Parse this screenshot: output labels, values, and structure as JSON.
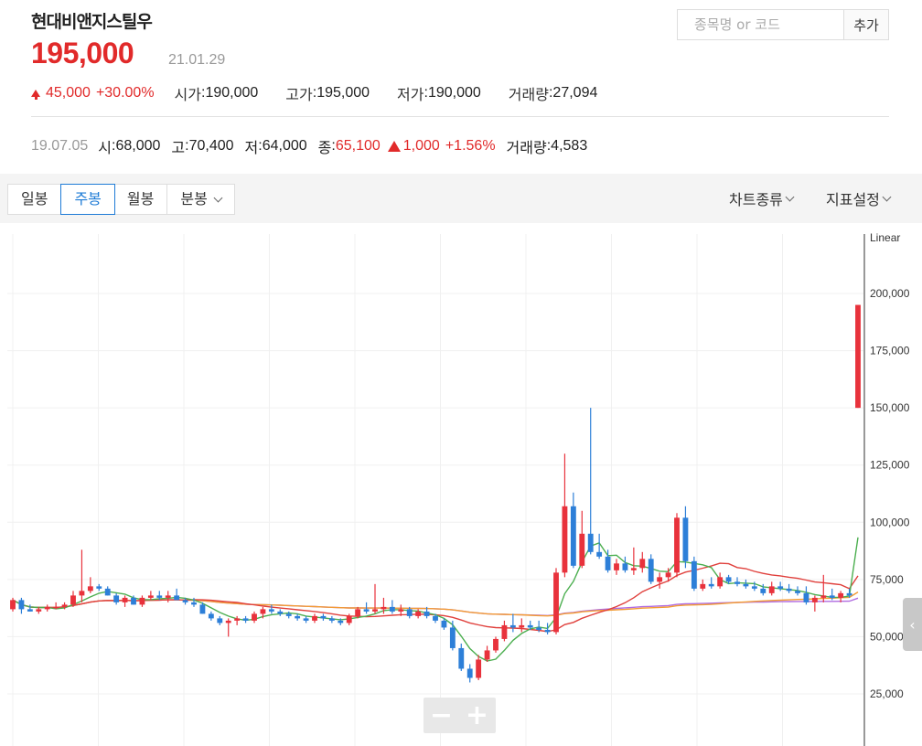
{
  "stock": {
    "name": "현대비앤지스틸우",
    "price": "195,000",
    "date": "21.01.29",
    "change": "45,000",
    "change_pct": "+30.00%",
    "open_label": "시가",
    "open": "190,000",
    "high_label": "고가",
    "high": "195,000",
    "low_label": "저가",
    "low": "190,000",
    "volume_label": "거래량",
    "volume": "27,094"
  },
  "search": {
    "placeholder": "종목명 or 코드",
    "add_label": "추가"
  },
  "history": {
    "date": "19.07.05",
    "open_label": "시",
    "open": "68,000",
    "high_label": "고",
    "high": "70,400",
    "low_label": "저",
    "low": "64,000",
    "close_label": "종",
    "close": "65,100",
    "change": "1,000",
    "change_pct": "+1.56%",
    "volume_label": "거래량",
    "volume": "4,583"
  },
  "toolbar": {
    "tabs": [
      {
        "label": "일봉"
      },
      {
        "label": "주봉"
      },
      {
        "label": "월봉"
      },
      {
        "label": "분봉"
      }
    ],
    "active_tab": "주봉",
    "chart_type_label": "차트종류",
    "indicator_label": "지표설정"
  },
  "colors": {
    "up": "#e8323c",
    "down": "#2d7fd8",
    "ma5": "#4caf50",
    "ma20": "#e0403c",
    "ma60": "#f39c34",
    "ma120": "#b06be0"
  },
  "chart_data": {
    "type": "candlestick",
    "scale_label": "Linear",
    "ylim": [
      0,
      225000
    ],
    "yticks": [
      25000,
      50000,
      75000,
      100000,
      125000,
      150000,
      175000,
      200000
    ],
    "ytick_labels": [
      "25,000",
      "50,000",
      "75,000",
      "100,000",
      "125,000",
      "150,000",
      "175,000",
      "200,000"
    ],
    "candles": [
      [
        62000,
        67000,
        61000,
        66000
      ],
      [
        66000,
        67000,
        60000,
        62000
      ],
      [
        62000,
        64000,
        61000,
        61000
      ],
      [
        61000,
        63000,
        60000,
        62000
      ],
      [
        62000,
        64000,
        61000,
        63000
      ],
      [
        63000,
        65000,
        62000,
        63000
      ],
      [
        63000,
        65000,
        62000,
        64000
      ],
      [
        64000,
        70000,
        63000,
        68000
      ],
      [
        68000,
        88000,
        65000,
        70000
      ],
      [
        70000,
        76000,
        69000,
        72000
      ],
      [
        72000,
        73000,
        70000,
        71000
      ],
      [
        71000,
        72000,
        68000,
        68000
      ],
      [
        68000,
        69000,
        64000,
        65000
      ],
      [
        65000,
        68000,
        63000,
        67000
      ],
      [
        67000,
        68000,
        64000,
        64000
      ],
      [
        64000,
        68000,
        63000,
        67000
      ],
      [
        67000,
        70000,
        66000,
        68000
      ],
      [
        68000,
        70000,
        66000,
        67000
      ],
      [
        67000,
        70000,
        65000,
        68000
      ],
      [
        68000,
        71000,
        66000,
        66000
      ],
      [
        66000,
        67000,
        64000,
        65000
      ],
      [
        65000,
        67000,
        63000,
        64000
      ],
      [
        64000,
        65000,
        60000,
        60000
      ],
      [
        60000,
        61000,
        57000,
        58000
      ],
      [
        58000,
        59000,
        55000,
        56000
      ],
      [
        56000,
        58000,
        50000,
        57000
      ],
      [
        57000,
        59000,
        55000,
        58000
      ],
      [
        58000,
        59000,
        56000,
        57000
      ],
      [
        57000,
        61000,
        56000,
        60000
      ],
      [
        60000,
        63000,
        58000,
        62000
      ],
      [
        62000,
        64000,
        60000,
        61000
      ],
      [
        61000,
        62000,
        59000,
        60000
      ],
      [
        60000,
        61000,
        58000,
        59000
      ],
      [
        59000,
        60000,
        57000,
        58000
      ],
      [
        58000,
        59000,
        56000,
        57000
      ],
      [
        57000,
        60000,
        56000,
        59000
      ],
      [
        59000,
        60000,
        57000,
        58000
      ],
      [
        58000,
        59000,
        56000,
        57000
      ],
      [
        57000,
        58000,
        55000,
        56000
      ],
      [
        56000,
        60000,
        55000,
        59000
      ],
      [
        59000,
        63000,
        58000,
        62000
      ],
      [
        62000,
        65000,
        60000,
        61000
      ],
      [
        61000,
        73000,
        60000,
        62000
      ],
      [
        62000,
        67000,
        60000,
        63000
      ],
      [
        63000,
        66000,
        60000,
        61000
      ],
      [
        61000,
        64000,
        59000,
        62000
      ],
      [
        62000,
        63000,
        58000,
        59000
      ],
      [
        59000,
        62000,
        58000,
        61000
      ],
      [
        61000,
        63000,
        58000,
        59000
      ],
      [
        59000,
        60000,
        56000,
        57000
      ],
      [
        57000,
        58000,
        53000,
        54000
      ],
      [
        54000,
        57000,
        44000,
        45000
      ],
      [
        45000,
        47000,
        35000,
        36000
      ],
      [
        36000,
        38000,
        30000,
        32000
      ],
      [
        32000,
        42000,
        31000,
        40000
      ],
      [
        40000,
        46000,
        39000,
        44000
      ],
      [
        44000,
        50000,
        43000,
        49000
      ],
      [
        49000,
        57000,
        48000,
        55000
      ],
      [
        55000,
        60000,
        52000,
        54000
      ],
      [
        54000,
        58000,
        52000,
        55000
      ],
      [
        55000,
        57000,
        53000,
        54000
      ],
      [
        54000,
        57000,
        52000,
        53000
      ],
      [
        53000,
        56000,
        51000,
        52000
      ],
      [
        52000,
        80000,
        51000,
        78000
      ],
      [
        78000,
        130000,
        76000,
        107000
      ],
      [
        107000,
        113000,
        80000,
        81000
      ],
      [
        81000,
        105000,
        80000,
        95000
      ],
      [
        95000,
        150000,
        86000,
        87000
      ],
      [
        87000,
        95000,
        84000,
        85000
      ],
      [
        85000,
        88000,
        78000,
        79000
      ],
      [
        79000,
        84000,
        77000,
        82000
      ],
      [
        82000,
        85000,
        78000,
        79000
      ],
      [
        79000,
        89000,
        77000,
        80000
      ],
      [
        80000,
        87000,
        78000,
        84000
      ],
      [
        84000,
        86000,
        73000,
        74000
      ],
      [
        74000,
        78000,
        71000,
        76000
      ],
      [
        76000,
        80000,
        74000,
        78000
      ],
      [
        78000,
        104000,
        76000,
        102000
      ],
      [
        102000,
        107000,
        80000,
        83000
      ],
      [
        83000,
        85000,
        70000,
        71000
      ],
      [
        71000,
        75000,
        70000,
        73000
      ],
      [
        73000,
        76000,
        71000,
        72000
      ],
      [
        72000,
        78000,
        71000,
        76000
      ],
      [
        76000,
        77000,
        73000,
        74000
      ],
      [
        74000,
        76000,
        72000,
        73000
      ],
      [
        73000,
        75000,
        71000,
        72000
      ],
      [
        72000,
        74000,
        70000,
        71000
      ],
      [
        71000,
        73000,
        68000,
        69000
      ],
      [
        69000,
        74000,
        68000,
        72000
      ],
      [
        72000,
        74000,
        70000,
        71000
      ],
      [
        71000,
        73000,
        69000,
        70000
      ],
      [
        70000,
        72000,
        68000,
        69000
      ],
      [
        69000,
        72000,
        64000,
        65000
      ],
      [
        65000,
        68000,
        61000,
        67000
      ],
      [
        67000,
        77000,
        65000,
        68000
      ],
      [
        68000,
        71000,
        66000,
        67000
      ],
      [
        67000,
        70000,
        65000,
        69000
      ],
      [
        69000,
        71000,
        67000,
        68000
      ],
      [
        150000,
        195000,
        150000,
        195000
      ]
    ]
  }
}
